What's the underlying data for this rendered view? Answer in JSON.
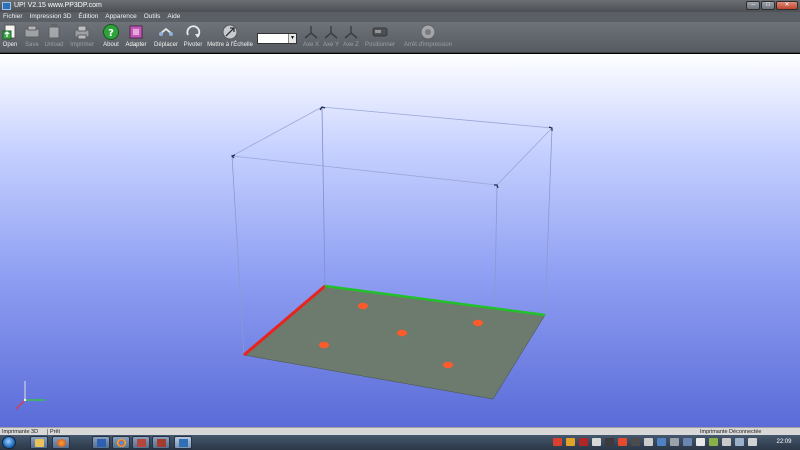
{
  "window": {
    "title": "UP!  V2.15 www.PP3DP.com"
  },
  "menu": [
    "Fichier",
    "Impression 3D",
    "Édition",
    "Apparence",
    "Outils",
    "Aide"
  ],
  "toolbar": {
    "buttons": [
      {
        "label": "Open",
        "icon": "open-file-icon",
        "enabled": true
      },
      {
        "label": "Save",
        "icon": "save-icon",
        "enabled": false
      },
      {
        "label": "Unload",
        "icon": "unload-icon",
        "enabled": false
      },
      {
        "label": "Imprimer",
        "icon": "printer-icon",
        "enabled": false
      },
      {
        "label": "About",
        "icon": "help-icon",
        "enabled": true
      },
      {
        "label": "Adapter",
        "icon": "fit-icon",
        "enabled": true
      },
      {
        "label": "Déplacer",
        "icon": "move-icon",
        "enabled": true
      },
      {
        "label": "Pivoter",
        "icon": "rotate-icon",
        "enabled": true
      },
      {
        "label": "Mettre à l'Échelle",
        "icon": "scale-icon",
        "enabled": true
      },
      {
        "label": "Axe X",
        "icon": "axis-x-icon",
        "enabled": false
      },
      {
        "label": "Axe Y",
        "icon": "axis-y-icon",
        "enabled": false
      },
      {
        "label": "Axe Z",
        "icon": "axis-z-icon",
        "enabled": false
      },
      {
        "label": "Positionner",
        "icon": "position-icon",
        "enabled": false
      },
      {
        "label": "Arrêt d'impression",
        "icon": "stop-print-icon",
        "enabled": false
      }
    ],
    "scale_value": ""
  },
  "status": {
    "printer_label": "Imprimante 3D",
    "state": "Prêt",
    "connection": "Imprimante Déconnectée"
  },
  "taskbar": {
    "clock": "22:09"
  },
  "colors": {
    "viewport_top": "#ffffff",
    "viewport_bottom": "#5a6bd8",
    "plate": "#6d7a6e",
    "axis_x": "#e8241c",
    "axis_y": "#21c12a",
    "hole": "#ff5a2a"
  }
}
